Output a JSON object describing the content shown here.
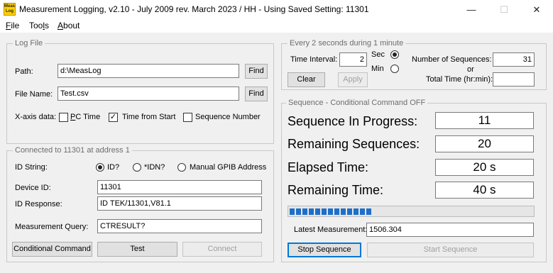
{
  "window": {
    "title": "Measurement Logging, v2.10 - July 2009 rev. March 2023 / HH - Using Saved Setting: 11301",
    "icon_text": "Meas Log",
    "controls": {
      "minimize": "—",
      "maximize": "☐",
      "close": "✕"
    }
  },
  "menu": [
    {
      "label": "File",
      "underline": "F"
    },
    {
      "label": "Tools",
      "underline": "l"
    },
    {
      "label": "About",
      "underline": "A"
    }
  ],
  "logfile": {
    "legend": "Log File",
    "path_label": "Path:",
    "path_value": "d:\\MeasLog",
    "filename_label": "File Name:",
    "filename_value": "Test.csv",
    "find_label": "Find",
    "xaxis_label": "X-axis data:",
    "pc_time_label": "PC Time",
    "pc_time_checked": false,
    "time_from_start_label": "Time from Start",
    "time_from_start_checked": true,
    "sequence_number_label": "Sequence Number",
    "sequence_number_checked": false
  },
  "connection": {
    "legend": "Connected to 11301 at address 1",
    "id_string_label": "ID String:",
    "opt_id": "ID?",
    "opt_idn": "*IDN?",
    "opt_manual": "Manual GPIB Address",
    "selected": "ID?",
    "device_id_label": "Device ID:",
    "device_id_value": "11301",
    "id_response_label": "ID Response:",
    "id_response_value": "ID TEK/11301,V81.1",
    "meas_query_label": "Measurement Query:",
    "meas_query_value": "CTRESULT?",
    "conditional_btn": "Conditional Command",
    "test_btn": "Test",
    "connect_btn": "Connect"
  },
  "timing": {
    "legend": "Every 2 seconds during 1 minute",
    "interval_label": "Time Interval:",
    "interval_value": "2",
    "sec_label": "Sec",
    "min_label": "Min",
    "unit_selected": "Sec",
    "num_seq_label": "Number of Sequences:",
    "num_seq_value": "31",
    "or_label": "or",
    "total_time_label": "Total Time (hr:min):",
    "total_time_value": "",
    "clear_btn": "Clear",
    "apply_btn": "Apply"
  },
  "sequence": {
    "legend": "Sequence - Conditional Command OFF",
    "in_progress_label": "Sequence In Progress:",
    "in_progress_value": "11",
    "remaining_seq_label": "Remaining Sequences:",
    "remaining_seq_value": "20",
    "elapsed_label": "Elapsed Time:",
    "elapsed_value": "20 s",
    "remaining_time_label": "Remaining Time:",
    "remaining_time_value": "40 s",
    "progress_fraction": 0.355,
    "latest_label": "Latest Measurement:",
    "latest_value": "1506.304",
    "stop_btn": "Stop Sequence",
    "start_btn": "Start Sequence"
  },
  "colors": {
    "accent": "#0078d7",
    "progress": "#1e6fc9",
    "group_border": "#c8c8c8"
  }
}
